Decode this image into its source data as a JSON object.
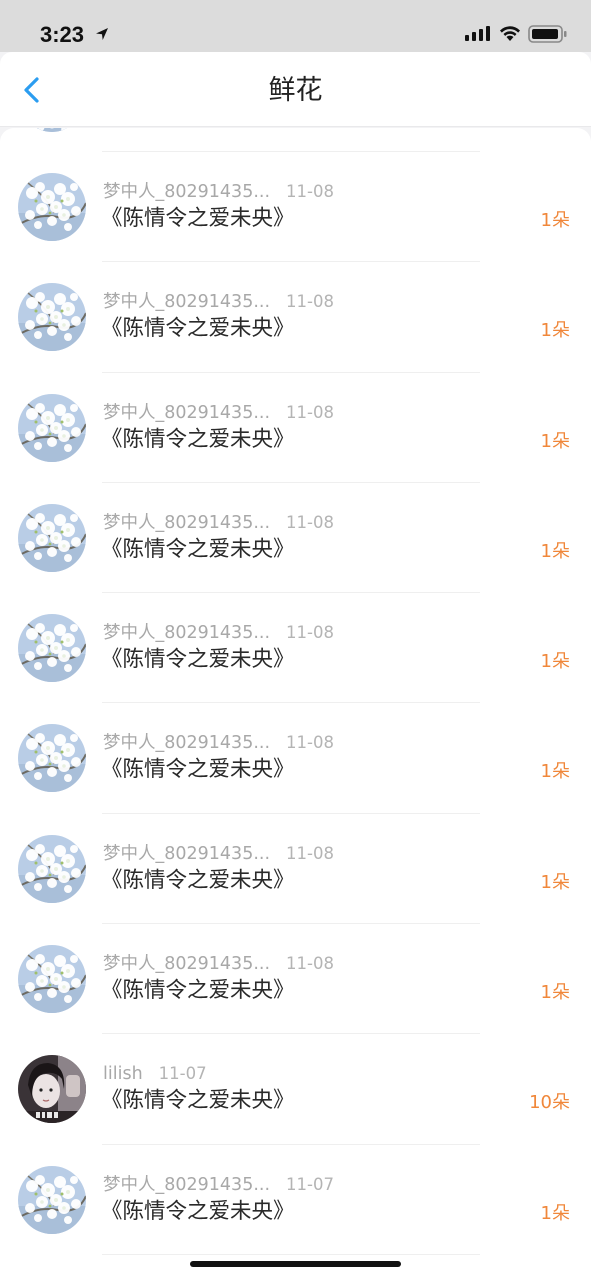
{
  "status_bar": {
    "time": "3:23",
    "icons": [
      "location-arrow-icon",
      "cellular-signal-icon",
      "wifi-icon",
      "battery-icon"
    ]
  },
  "nav": {
    "title": "鲜花",
    "back_icon": "chevron-left-icon",
    "accent_color": "#2b9df0"
  },
  "colors": {
    "count": "#f0873a",
    "secondary_text": "#a8a8a8",
    "primary_text": "#2a2a2a"
  },
  "list": {
    "items": [
      {
        "user": "梦中人_80291435...",
        "date": "11-08",
        "title": "《陈情令之爱未央》",
        "count": "1朵",
        "avatar": "flower-avatar"
      },
      {
        "user": "梦中人_80291435...",
        "date": "11-08",
        "title": "《陈情令之爱未央》",
        "count": "1朵",
        "avatar": "flower-avatar"
      },
      {
        "user": "梦中人_80291435...",
        "date": "11-08",
        "title": "《陈情令之爱未央》",
        "count": "1朵",
        "avatar": "flower-avatar"
      },
      {
        "user": "梦中人_80291435...",
        "date": "11-08",
        "title": "《陈情令之爱未央》",
        "count": "1朵",
        "avatar": "flower-avatar"
      },
      {
        "user": "梦中人_80291435...",
        "date": "11-08",
        "title": "《陈情令之爱未央》",
        "count": "1朵",
        "avatar": "flower-avatar"
      },
      {
        "user": "梦中人_80291435...",
        "date": "11-08",
        "title": "《陈情令之爱未央》",
        "count": "1朵",
        "avatar": "flower-avatar"
      },
      {
        "user": "梦中人_80291435...",
        "date": "11-08",
        "title": "《陈情令之爱未央》",
        "count": "1朵",
        "avatar": "flower-avatar"
      },
      {
        "user": "梦中人_80291435...",
        "date": "11-08",
        "title": "《陈情令之爱未央》",
        "count": "1朵",
        "avatar": "flower-avatar"
      },
      {
        "user": "lilish",
        "date": "11-07",
        "title": "《陈情令之爱未央》",
        "count": "10朵",
        "avatar": "portrait-avatar"
      },
      {
        "user": "梦中人_80291435...",
        "date": "11-07",
        "title": "《陈情令之爱未央》",
        "count": "1朵",
        "avatar": "flower-avatar"
      }
    ]
  }
}
